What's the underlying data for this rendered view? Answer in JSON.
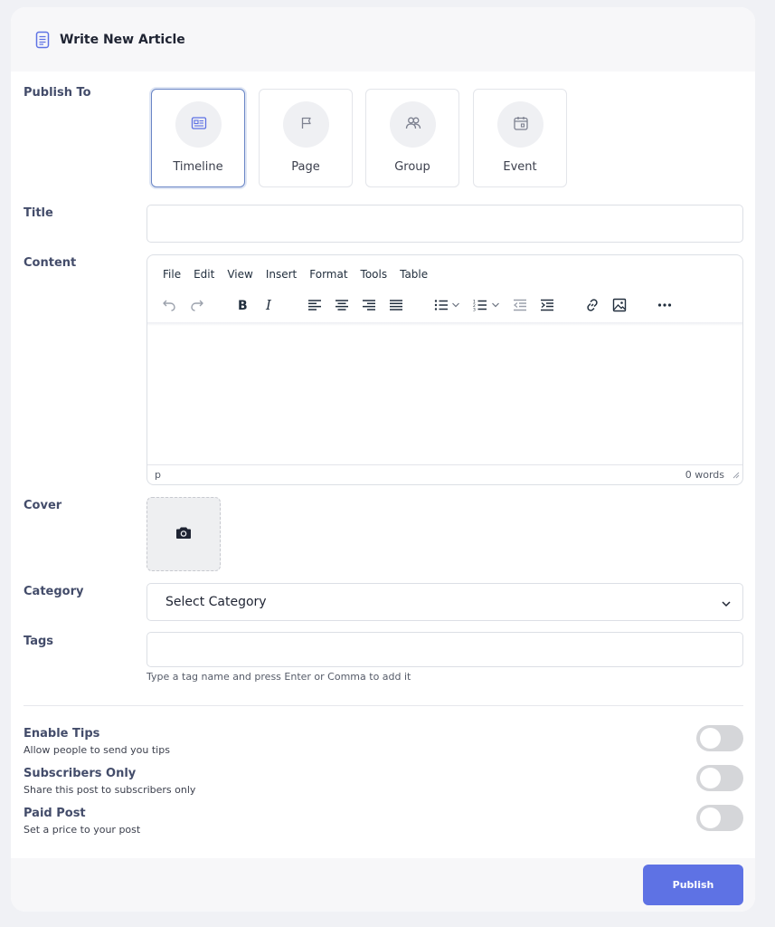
{
  "header": {
    "title": "Write New Article",
    "icon": "document-icon"
  },
  "publish_to": {
    "label": "Publish To",
    "options": [
      {
        "label": "Timeline",
        "icon": "newspaper-icon",
        "selected": true
      },
      {
        "label": "Page",
        "icon": "flag-icon",
        "selected": false
      },
      {
        "label": "Group",
        "icon": "users-icon",
        "selected": false
      },
      {
        "label": "Event",
        "icon": "calendar-icon",
        "selected": false
      }
    ]
  },
  "title_field": {
    "label": "Title",
    "value": ""
  },
  "content": {
    "label": "Content",
    "menu": [
      "File",
      "Edit",
      "View",
      "Insert",
      "Format",
      "Tools",
      "Table"
    ],
    "status_path": "p",
    "word_count": "0 words"
  },
  "cover": {
    "label": "Cover",
    "icon": "camera-icon"
  },
  "category": {
    "label": "Category",
    "selected": "Select Category"
  },
  "tags": {
    "label": "Tags",
    "value": "",
    "help": "Type a tag name and press Enter or Comma to add it"
  },
  "toggles": [
    {
      "title": "Enable Tips",
      "description": "Allow people to send you tips",
      "on": false
    },
    {
      "title": "Subscribers Only",
      "description": "Share this post to subscribers only",
      "on": false
    },
    {
      "title": "Paid Post",
      "description": "Set a price to your post",
      "on": false
    }
  ],
  "footer": {
    "publish_label": "Publish"
  },
  "colors": {
    "accent": "#5e72e4",
    "selected_border": "#6a86c6",
    "label": "#434c6a"
  }
}
